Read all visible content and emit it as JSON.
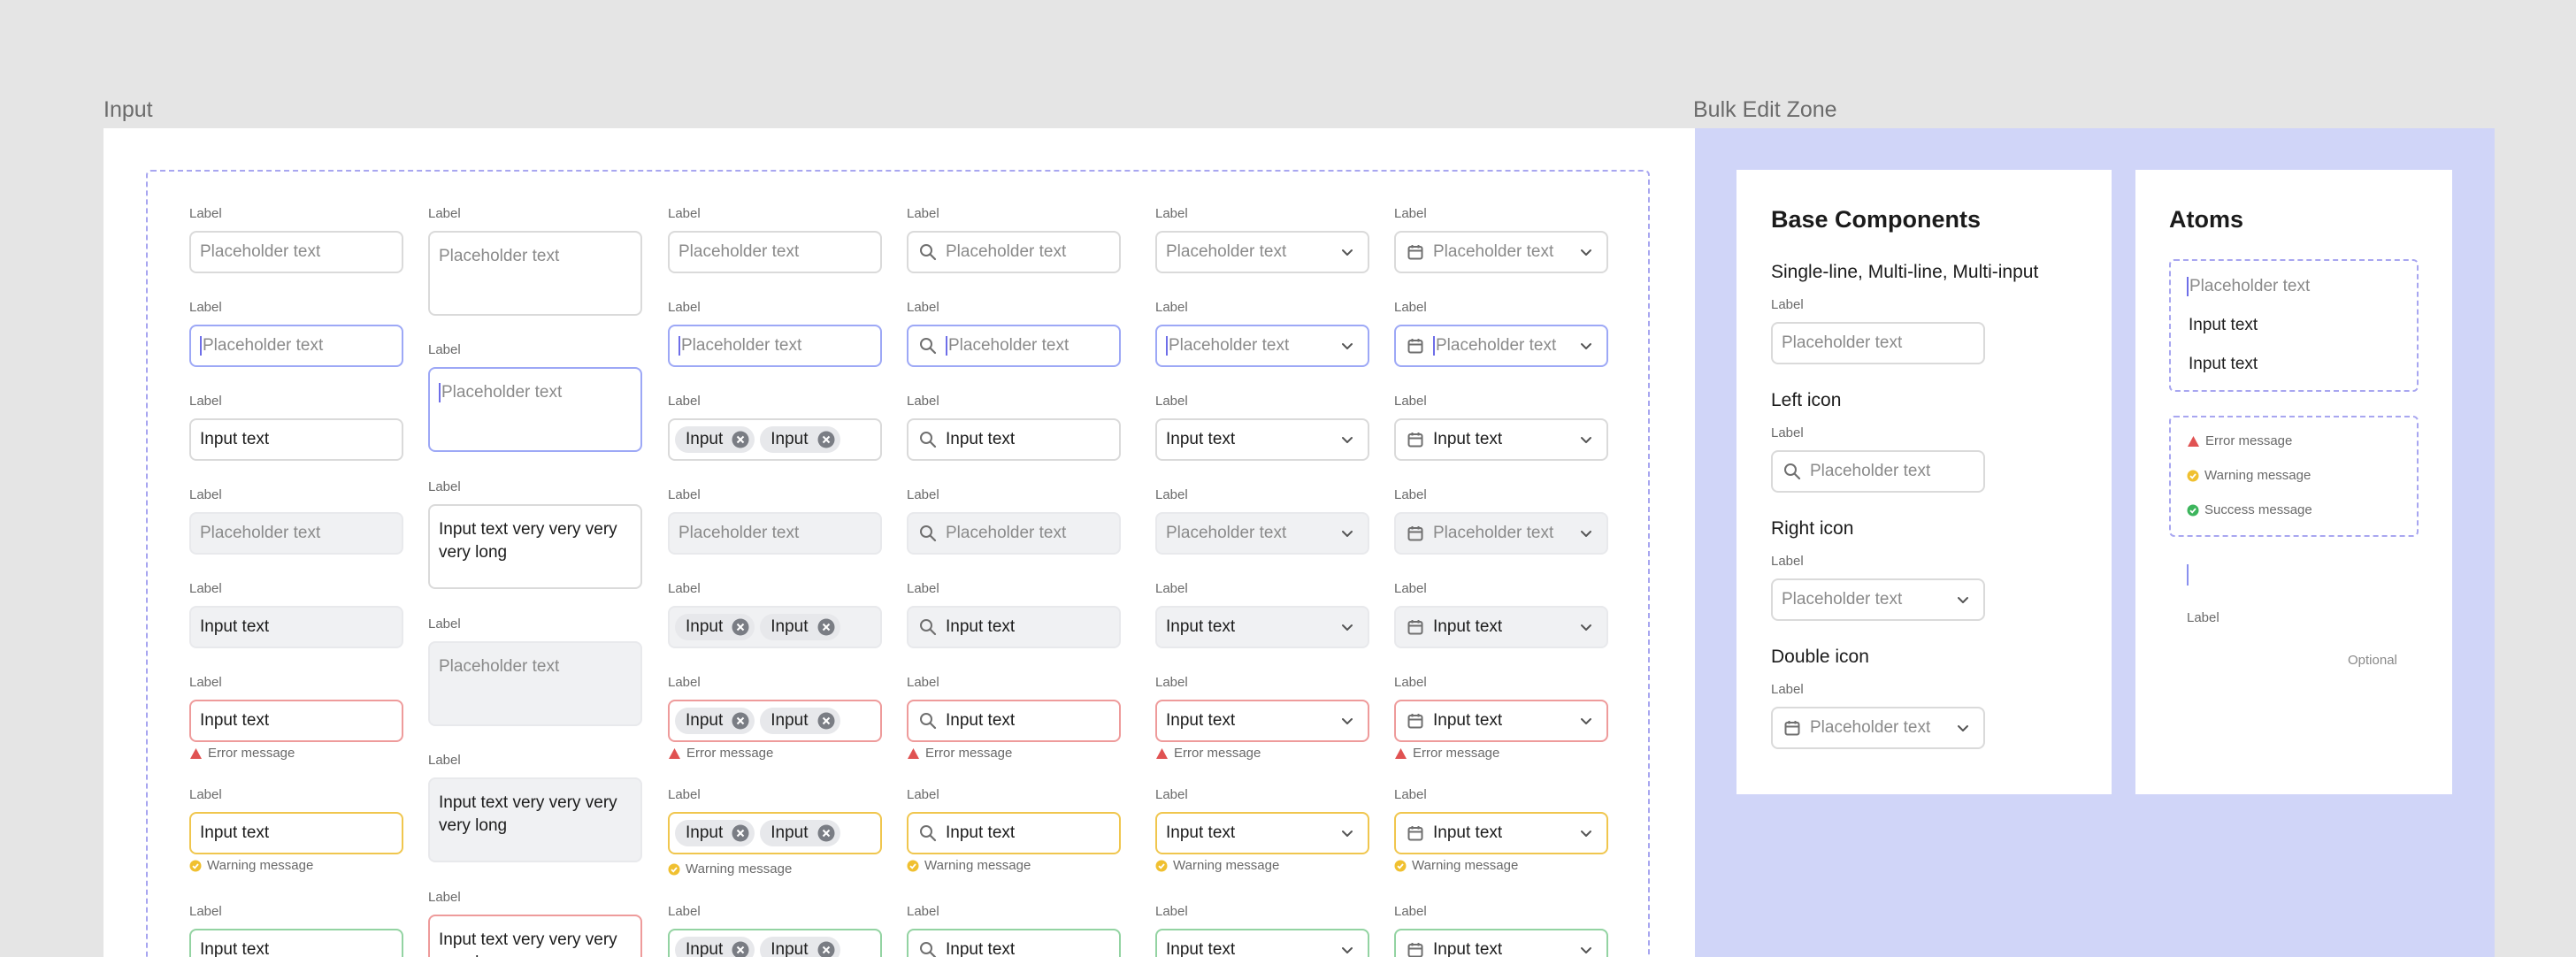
{
  "frames": {
    "input_title": "Input",
    "bulk_title": "Bulk Edit Zone"
  },
  "common": {
    "label": "Label",
    "placeholder": "Placeholder text",
    "input_text": "Input text",
    "long_text": "Input text very very very very long",
    "chip": "Input",
    "error": "Error message",
    "warning": "Warning message",
    "success": "Success message",
    "optional": "Optional"
  },
  "grid": {
    "rows": [
      "default",
      "focus",
      "filled",
      "disabled-empty",
      "disabled-filled",
      "error",
      "warning",
      "success"
    ],
    "columns": [
      "single-line",
      "multi-line",
      "multi-input",
      "left-icon",
      "right-icon",
      "double-icon"
    ]
  },
  "base": {
    "title": "Base Components",
    "sections": [
      {
        "title": "Single-line, Multi-line, Multi-input",
        "icon": "none"
      },
      {
        "title": "Left icon",
        "icon": "search-icon"
      },
      {
        "title": "Right icon",
        "icon": "chevron-down-icon"
      },
      {
        "title": "Double icon",
        "icon": "calendar-icon"
      }
    ]
  },
  "atoms": {
    "title": "Atoms"
  },
  "colors": {
    "focus": "#9da8f6",
    "error": "#ee9b9b",
    "error_icon": "#e05252",
    "warning": "#f0c64e",
    "success": "#93d3a2",
    "success_icon": "#3cb55c",
    "bulk_background": "#d0d5f8",
    "dashed": "#a8a6f0"
  }
}
